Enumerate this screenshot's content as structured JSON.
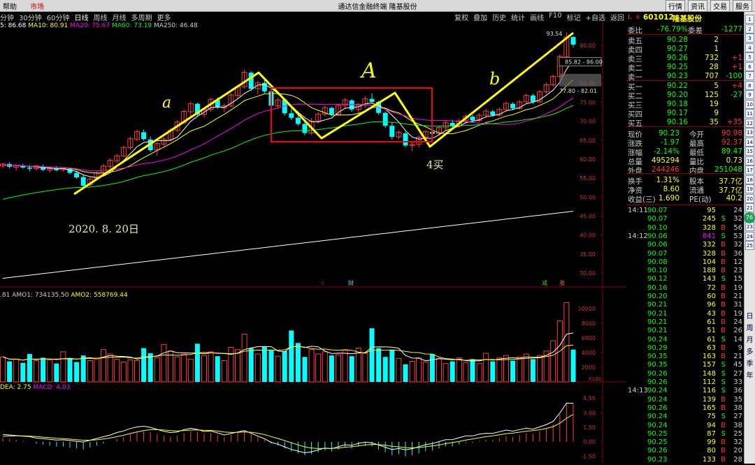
{
  "titlebar": {
    "menu_help": "帮助",
    "menu_market": "市场",
    "app_title": "通达信金融终端  隆基股份",
    "buttons": [
      "行情",
      "资讯",
      "交易",
      "服务"
    ]
  },
  "periods": [
    "分钟",
    "30分钟",
    "60分钟",
    "日线",
    "周线",
    "月线",
    "多周期",
    "更多"
  ],
  "active_period": "日线",
  "tools": [
    "复权",
    "叠加",
    "历史",
    "统计",
    "画线",
    "F10",
    "标记",
    "+自选",
    "返回"
  ],
  "ma_legend": {
    "ma5": "5: 86.68",
    "ma10": "MA10: 80.91",
    "ma20": "MA20: 75.67",
    "ma60": "MA60: 73.19",
    "ma250": "MA250: 46.48"
  },
  "price_axis": [
    "90.00",
    "85.00",
    "80.00",
    "75.00",
    "70.00",
    "65.00",
    "60.00",
    "55.00",
    "50.00",
    "45.00",
    "40.00",
    "35.00",
    "30.00"
  ],
  "price_annotations": {
    "high_label": "93.54",
    "range_a": "85.82 - 86.00",
    "range_b": "77.80 - 82.01"
  },
  "event_markers": {
    "m1": "☆",
    "m2": "财",
    "m3": "减",
    "m4": "涨"
  },
  "handwriting": {
    "a": "a",
    "A": "A",
    "b": "b",
    "buy": "4买",
    "date": "2020. 8. 20日"
  },
  "volume_legend": {
    "prefix": ".81",
    "amo1": "AMO1: 734135.50",
    "amo2": "AMO2: 558769.44"
  },
  "volume_axis": [
    "10000",
    "8000",
    "6000",
    "4000",
    "2000"
  ],
  "volume_unit": "X100",
  "macd_legend": {
    "dea": "DEA: 2.75",
    "macd": "MACD: 4.03"
  },
  "macd_axis": [
    "4.56",
    "3.00",
    "1.50",
    "0.00",
    "-1.50"
  ],
  "colors": {
    "up": "#ff3c3c",
    "down": "#00ffff",
    "ma5": "#ffffff",
    "ma10": "#ffff00",
    "ma20": "#ff00ff",
    "ma60": "#00ff00",
    "ma250": "#ffffff",
    "annotation": "#ffff00",
    "box": "#ff0000"
  },
  "quote": {
    "code": "601012",
    "name": "隆基股份",
    "badge_l": "L",
    "badge_r": "R",
    "weibi_label": "委比",
    "weibi": "-76.79%",
    "weicha_label": "委差",
    "weicha": "-1277",
    "asks": [
      {
        "label": "卖五",
        "price": "90.28",
        "vol": "2",
        "chg": ""
      },
      {
        "label": "卖四",
        "price": "90.27",
        "vol": "1",
        "chg": ""
      },
      {
        "label": "卖三",
        "price": "90.26",
        "vol": "732",
        "chg": "+1"
      },
      {
        "label": "卖二",
        "price": "90.25",
        "vol": "28",
        "chg": "+1"
      },
      {
        "label": "卖一",
        "price": "90.23",
        "vol": "707",
        "chg": "-100"
      }
    ],
    "bids": [
      {
        "label": "买一",
        "price": "90.22",
        "vol": "5",
        "chg": "+4"
      },
      {
        "label": "买二",
        "price": "90.20",
        "vol": "125",
        "chg": "-27"
      },
      {
        "label": "买三",
        "price": "90.18",
        "vol": "19",
        "chg": ""
      },
      {
        "label": "买四",
        "price": "90.17",
        "vol": "9",
        "chg": ""
      },
      {
        "label": "买五",
        "price": "90.16",
        "vol": "35",
        "chg": "+35"
      }
    ],
    "stats": [
      {
        "l1": "现价",
        "v1": "90.23",
        "l2": "今开",
        "v2": "90.98"
      },
      {
        "l1": "涨跌",
        "v1": "-1.97",
        "l2": "最高",
        "v2": "92.37"
      },
      {
        "l1": "涨幅",
        "v1": "-2.14%",
        "l2": "最低",
        "v2": "89.47"
      },
      {
        "l1": "总量",
        "v1": "495294",
        "l2": "量比",
        "v2": "0.73"
      },
      {
        "l1": "外盘",
        "v1": "244246",
        "l2": "内盘",
        "v2": "251048"
      }
    ],
    "stats2": [
      {
        "l1": "换手",
        "v1": "1.31%",
        "l2": "股本",
        "v2": "37.7亿"
      },
      {
        "l1": "净资",
        "v1": "8.60",
        "l2": "流通",
        "v2": "37.7亿"
      },
      {
        "l1": "收益(三)",
        "v1": "1.690",
        "l2": "PE(动)",
        "v2": "40.2"
      }
    ]
  },
  "ticks": [
    {
      "time": "14:11",
      "price": "90.07",
      "vol": "95",
      "side": "",
      "n": "24"
    },
    {
      "time": "",
      "price": "90.07",
      "vol": "245",
      "side": "S",
      "n": "32"
    },
    {
      "time": "",
      "price": "90.10",
      "vol": "328",
      "side": "B",
      "n": "56"
    },
    {
      "time": "14:12",
      "price": "90.06",
      "vol": "841",
      "side": "S",
      "n": "53"
    },
    {
      "time": "",
      "price": "90.06",
      "vol": "332",
      "side": "B",
      "n": "32"
    },
    {
      "time": "",
      "price": "90.07",
      "vol": "328",
      "side": "B",
      "n": "36"
    },
    {
      "time": "",
      "price": "90.08",
      "vol": "104",
      "side": "B",
      "n": "12"
    },
    {
      "time": "",
      "price": "90.10",
      "vol": "188",
      "side": "B",
      "n": "23"
    },
    {
      "time": "",
      "price": "90.12",
      "vol": "143",
      "side": "S",
      "n": "15"
    },
    {
      "time": "",
      "price": "90.16",
      "vol": "72",
      "side": "B",
      "n": "19"
    },
    {
      "time": "",
      "price": "90.20",
      "vol": "60",
      "side": "B",
      "n": "21"
    },
    {
      "time": "",
      "price": "90.21",
      "vol": "96",
      "side": "B",
      "n": "31"
    },
    {
      "time": "",
      "price": "90.21",
      "vol": "43",
      "side": "B",
      "n": "19"
    },
    {
      "time": "",
      "price": "90.21",
      "vol": "61",
      "side": "B",
      "n": "24"
    },
    {
      "time": "",
      "price": "90.21",
      "vol": "51",
      "side": "B",
      "n": "26"
    },
    {
      "time": "",
      "price": "90.24",
      "vol": "61",
      "side": "S",
      "n": "14"
    },
    {
      "time": "",
      "price": "90.29",
      "vol": "63",
      "side": "B",
      "n": "9"
    },
    {
      "time": "",
      "price": "90.35",
      "vol": "163",
      "side": "B",
      "n": "21"
    },
    {
      "time": "",
      "price": "90.35",
      "vol": "157",
      "side": "S",
      "n": "45"
    },
    {
      "time": "",
      "price": "90.26",
      "vol": "148",
      "side": "S",
      "n": "27"
    },
    {
      "time": "",
      "price": "90.26",
      "vol": "112",
      "side": "S",
      "n": "33"
    },
    {
      "time": "14:13",
      "price": "90.24",
      "vol": "116",
      "side": "S",
      "n": "36"
    },
    {
      "time": "",
      "price": "90.24",
      "vol": "139",
      "side": "B",
      "n": "35"
    },
    {
      "time": "",
      "price": "90.26",
      "vol": "165",
      "side": "B",
      "n": "38"
    },
    {
      "time": "",
      "price": "90.24",
      "vol": "75",
      "side": "S",
      "n": "27"
    },
    {
      "time": "",
      "price": "90.24",
      "vol": "94",
      "side": "B",
      "n": "38"
    },
    {
      "time": "",
      "price": "90.25",
      "vol": "87",
      "side": "S",
      "n": "25"
    },
    {
      "time": "",
      "price": "90.25",
      "vol": "99",
      "side": "B",
      "n": "32"
    },
    {
      "time": "",
      "price": "90.26",
      "vol": "80",
      "side": "B",
      "n": "20"
    },
    {
      "time": "",
      "price": "90.23",
      "vol": "133",
      "side": "B",
      "n": "28"
    }
  ],
  "sidebar_items": [
    "1",
    "2",
    "3",
    "4",
    "5",
    "6",
    "7",
    "8",
    "9",
    "10",
    "11",
    "12",
    "13",
    "14",
    "15",
    "16",
    "17",
    "18",
    "19",
    "20",
    "21",
    "22",
    "23",
    "24",
    "25"
  ],
  "sidebar_badge": "76",
  "sidebar_labels": [
    "日",
    "周",
    "月",
    "多",
    "季",
    "年"
  ],
  "chart_data": [
    {
      "type": "candlestick",
      "title": "",
      "ylim": [
        26,
        98
      ],
      "y_ticks": [
        90,
        85,
        80,
        75,
        70,
        65,
        60,
        55,
        50,
        45,
        40,
        35,
        30
      ],
      "candles": [
        [
          58.2,
          59.0,
          57.6,
          58.7
        ],
        [
          58.7,
          59.2,
          57.6,
          58.0
        ],
        [
          57.9,
          58.6,
          57.0,
          58.4
        ],
        [
          58.2,
          58.8,
          57.5,
          57.8
        ],
        [
          57.8,
          58.4,
          56.8,
          57.5
        ],
        [
          57.5,
          58.5,
          57.0,
          58.2
        ],
        [
          58.0,
          58.6,
          56.9,
          57.2
        ],
        [
          57.1,
          57.8,
          56.5,
          57.5
        ],
        [
          57.5,
          58.2,
          56.8,
          57.1
        ],
        [
          57.2,
          57.9,
          56.7,
          57.6
        ],
        [
          57.4,
          57.8,
          56.0,
          56.4
        ],
        [
          56.4,
          57.0,
          54.8,
          55.2
        ],
        [
          55.3,
          55.8,
          52.5,
          53.0
        ],
        [
          53.2,
          55.2,
          52.8,
          54.8
        ],
        [
          55.0,
          56.8,
          54.5,
          56.4
        ],
        [
          56.4,
          58.8,
          56.1,
          58.2
        ],
        [
          58.1,
          60.2,
          57.6,
          59.7
        ],
        [
          59.5,
          61.4,
          59.0,
          60.9
        ],
        [
          60.8,
          63.5,
          60.5,
          63.1
        ],
        [
          63.0,
          65.9,
          62.5,
          65.4
        ],
        [
          65.2,
          67.8,
          64.8,
          67.3
        ],
        [
          67.1,
          67.8,
          64.9,
          65.3
        ],
        [
          65.2,
          66.0,
          61.9,
          62.4
        ],
        [
          62.5,
          64.6,
          60.9,
          64.1
        ],
        [
          64.0,
          65.8,
          63.4,
          65.3
        ],
        [
          65.2,
          68.2,
          64.8,
          67.6
        ],
        [
          67.6,
          70.3,
          67.1,
          69.8
        ],
        [
          69.6,
          73.1,
          69.3,
          72.6
        ],
        [
          72.5,
          75.1,
          70.9,
          74.6
        ],
        [
          74.6,
          74.9,
          71.3,
          71.8
        ],
        [
          71.8,
          73.6,
          71.0,
          73.1
        ],
        [
          73.1,
          76.2,
          72.5,
          75.8
        ],
        [
          75.6,
          76.3,
          73.2,
          73.6
        ],
        [
          73.5,
          74.6,
          72.4,
          74.1
        ],
        [
          74.0,
          77.3,
          73.8,
          76.9
        ],
        [
          76.8,
          79.6,
          76.1,
          79.1
        ],
        [
          79.1,
          83.6,
          78.6,
          82.9
        ],
        [
          82.8,
          83.2,
          78.0,
          78.6
        ],
        [
          78.6,
          80.6,
          77.1,
          80.1
        ],
        [
          80.1,
          81.3,
          77.4,
          77.9
        ],
        [
          77.9,
          78.2,
          73.6,
          74.1
        ],
        [
          74.1,
          76.2,
          73.3,
          75.6
        ],
        [
          75.7,
          76.1,
          71.5,
          72.1
        ],
        [
          72.1,
          73.2,
          70.3,
          70.9
        ],
        [
          70.9,
          72.6,
          68.8,
          69.3
        ],
        [
          69.3,
          70.2,
          66.3,
          66.9
        ],
        [
          66.9,
          70.8,
          66.4,
          70.1
        ],
        [
          70.1,
          72.4,
          69.3,
          71.9
        ],
        [
          71.9,
          74.1,
          71.3,
          73.6
        ],
        [
          73.5,
          73.8,
          71.3,
          71.8
        ],
        [
          71.8,
          74.6,
          71.5,
          74.2
        ],
        [
          74.2,
          76.1,
          73.2,
          75.6
        ],
        [
          75.5,
          75.8,
          72.5,
          73.1
        ],
        [
          73.1,
          74.8,
          72.1,
          74.3
        ],
        [
          74.3,
          76.6,
          73.6,
          75.9
        ],
        [
          75.9,
          77.3,
          74.7,
          75.1
        ],
        [
          75.1,
          75.4,
          71.7,
          72.2
        ],
        [
          72.2,
          72.6,
          68.2,
          68.8
        ],
        [
          68.8,
          69.7,
          65.2,
          65.9
        ],
        [
          65.9,
          67.6,
          65.3,
          67.1
        ],
        [
          66.8,
          67.3,
          63.2,
          63.6
        ],
        [
          63.6,
          64.8,
          62.1,
          63.9
        ],
        [
          63.9,
          66.3,
          63.1,
          65.8
        ],
        [
          65.8,
          67.7,
          65.2,
          67.3
        ],
        [
          67.2,
          68.3,
          65.9,
          66.7
        ],
        [
          66.7,
          68.9,
          66.3,
          68.4
        ],
        [
          68.3,
          70.1,
          67.6,
          69.6
        ],
        [
          69.6,
          70.4,
          68.1,
          68.7
        ],
        [
          68.7,
          70.6,
          68.2,
          70.1
        ],
        [
          70.1,
          71.9,
          69.4,
          71.3
        ],
        [
          71.2,
          71.7,
          69.6,
          70.2
        ],
        [
          70.2,
          72.1,
          69.8,
          71.6
        ],
        [
          71.6,
          73.2,
          70.9,
          72.7
        ],
        [
          72.6,
          73.0,
          71.2,
          71.6
        ],
        [
          71.6,
          73.6,
          71.3,
          73.1
        ],
        [
          73.1,
          75.2,
          72.6,
          74.7
        ],
        [
          74.6,
          75.0,
          72.9,
          73.4
        ],
        [
          73.4,
          75.6,
          73.0,
          75.1
        ],
        [
          75.1,
          77.3,
          74.6,
          76.8
        ],
        [
          76.8,
          77.2,
          74.6,
          75.1
        ],
        [
          75.1,
          78.3,
          74.8,
          77.8
        ],
        [
          77.8,
          80.2,
          77.3,
          79.6
        ],
        [
          79.6,
          82.3,
          79.1,
          81.8
        ],
        [
          81.8,
          87.6,
          81.4,
          87.1
        ],
        [
          87.0,
          93.5,
          86.6,
          92.2
        ],
        [
          92.2,
          92.4,
          89.5,
          90.2
        ]
      ],
      "moving_averages": [
        {
          "name": "MA5",
          "value": 86.68
        },
        {
          "name": "MA10",
          "value": 80.91
        },
        {
          "name": "MA20",
          "value": 75.67
        },
        {
          "name": "MA60",
          "value": 73.19
        },
        {
          "name": "MA250",
          "value": 46.48
        }
      ]
    },
    {
      "type": "bar",
      "title": "",
      "ylim": [
        0,
        11500
      ],
      "y_ticks": [
        10000,
        8000,
        6000,
        4000,
        2000
      ],
      "values": [
        3400,
        2800,
        3100,
        2600,
        3800,
        2900,
        3300,
        3000,
        2500,
        4100,
        3200,
        2700,
        3600,
        2900,
        3300,
        4400,
        3800,
        3100,
        2700,
        3000,
        2900,
        4600,
        3900,
        3300,
        5100,
        4200,
        3400,
        3800,
        3100,
        5200,
        3600,
        4100,
        3500,
        2900,
        4700,
        4400,
        6500,
        4600,
        3800,
        4800,
        4300,
        3500,
        4200,
        7000,
        5300,
        3400,
        4400,
        3800,
        4100,
        3600,
        3700,
        4300,
        3500,
        4600,
        3900,
        7300,
        4600,
        3400,
        4400,
        3200,
        2400,
        2800,
        3300,
        2700,
        3800,
        3200,
        2500,
        2800,
        3300,
        2600,
        3100,
        2500,
        3900,
        2800,
        3300,
        3600,
        2900,
        3400,
        3800,
        3100,
        3600,
        4200,
        5600,
        8300,
        10800,
        4400
      ],
      "colors_up": true
    },
    {
      "type": "bar",
      "title": "",
      "ylim": [
        -2.2,
        5.2
      ],
      "y_ticks": [
        4.56,
        3.0,
        1.5,
        0.0,
        -1.5
      ],
      "series": [
        {
          "name": "MACD",
          "values": [
            0.4,
            0.3,
            0.2,
            0.1,
            0.0,
            -0.2,
            -0.3,
            -0.4,
            -0.5,
            -0.5,
            -0.6,
            -0.7,
            -0.8,
            -0.6,
            -0.4,
            -0.2,
            0.0,
            0.3,
            0.5,
            0.8,
            1.0,
            1.1,
            1.0,
            0.8,
            0.6,
            0.5,
            0.6,
            0.9,
            1.1,
            1.0,
            0.8,
            0.9,
            0.7,
            0.5,
            0.7,
            0.9,
            1.1,
            0.8,
            0.5,
            0.2,
            -0.2,
            -0.4,
            -0.7,
            -1.0,
            -1.2,
            -1.4,
            -1.3,
            -1.1,
            -0.9,
            -1.0,
            -0.8,
            -0.6,
            -0.7,
            -0.5,
            -0.4,
            -0.5,
            -0.8,
            -1.1,
            -1.4,
            -1.3,
            -1.5,
            -1.4,
            -1.2,
            -1.0,
            -0.9,
            -0.7,
            -0.5,
            -0.5,
            -0.3,
            -0.1,
            -0.1,
            0.1,
            0.2,
            0.2,
            0.4,
            0.6,
            0.5,
            0.7,
            0.9,
            0.8,
            1.1,
            1.4,
            1.8,
            2.8,
            4.0,
            4.0
          ]
        }
      ]
    }
  ]
}
